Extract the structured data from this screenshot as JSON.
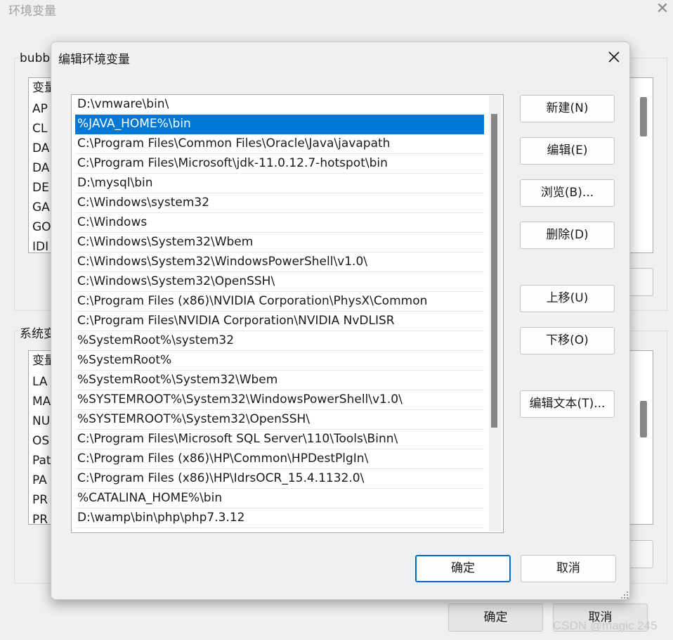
{
  "background_window": {
    "title": "环境变量",
    "close_glyph": "✕",
    "user_group_label": "bubb",
    "user_list_rows": [
      "变量",
      "AP",
      "CL",
      "DA",
      "DA",
      "DE",
      "GA",
      "GO",
      "IDI"
    ],
    "system_group_label": "系统变",
    "system_list_rows": [
      "变量",
      "LA",
      "MA",
      "NU",
      "OS",
      "Pat",
      "PA",
      "PR",
      "PR"
    ],
    "ok_label": "确定",
    "cancel_label": "取消"
  },
  "dialog": {
    "title": "编辑环境变量",
    "close_glyph": "✕",
    "selected_index": 1,
    "paths": [
      "D:\\vmware\\bin\\",
      "%JAVA_HOME%\\bin",
      "C:\\Program Files\\Common Files\\Oracle\\Java\\javapath",
      "C:\\Program Files\\Microsoft\\jdk-11.0.12.7-hotspot\\bin",
      "D:\\mysql\\bin",
      "C:\\Windows\\system32",
      "C:\\Windows",
      "C:\\Windows\\System32\\Wbem",
      "C:\\Windows\\System32\\WindowsPowerShell\\v1.0\\",
      "C:\\Windows\\System32\\OpenSSH\\",
      "C:\\Program Files (x86)\\NVIDIA Corporation\\PhysX\\Common",
      "C:\\Program Files\\NVIDIA Corporation\\NVIDIA NvDLISR",
      "%SystemRoot%\\system32",
      "%SystemRoot%",
      "%SystemRoot%\\System32\\Wbem",
      "%SYSTEMROOT%\\System32\\WindowsPowerShell\\v1.0\\",
      "%SYSTEMROOT%\\System32\\OpenSSH\\",
      "C:\\Program Files\\Microsoft SQL Server\\110\\Tools\\Binn\\",
      "C:\\Program Files (x86)\\HP\\Common\\HPDestPlgIn\\",
      "C:\\Program Files (x86)\\HP\\IdrsOCR_15.4.1132.0\\",
      "%CATALINA_HOME%\\bin",
      "D:\\wamp\\bin\\php\\php7.3.12"
    ],
    "buttons": {
      "new": "新建(N)",
      "edit": "编辑(E)",
      "browse": "浏览(B)...",
      "delete": "删除(D)",
      "move_up": "上移(U)",
      "move_down": "下移(O)",
      "edit_text": "编辑文本(T)..."
    },
    "ok_label": "确定",
    "cancel_label": "取消",
    "accent_color": "#0078d7"
  },
  "watermark": "CSDN @magic 245"
}
